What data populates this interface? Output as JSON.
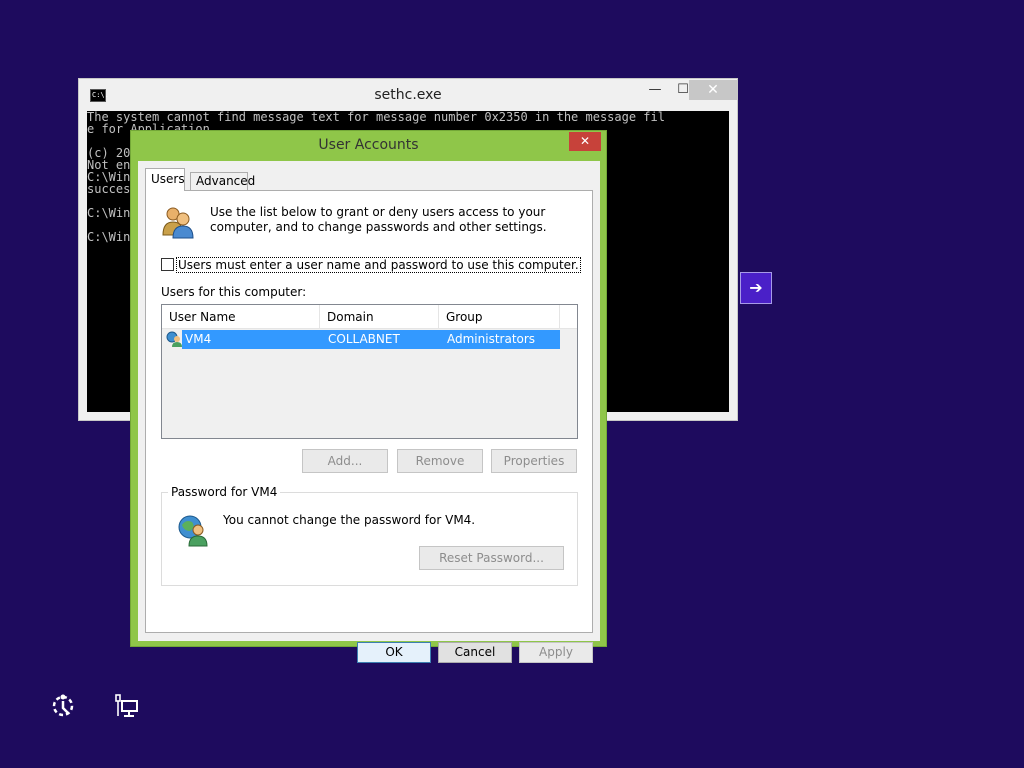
{
  "cmd": {
    "icon_text": "C:\\.",
    "title": "sethc.exe",
    "min_glyph": "—",
    "max_glyph": "☐",
    "close_glyph": "✕",
    "lines": [
      "The system cannot find message text for message number 0x2350 in the message fil",
      "e for Application",
      "",
      "(c) 20",
      "Not en",
      "C:\\Win",
      "succes",
      "",
      "C:\\Win",
      "",
      "C:\\Win"
    ]
  },
  "arrow": {
    "glyph": "➔"
  },
  "dialog": {
    "title": "User Accounts",
    "close_glyph": "✕",
    "tabs": [
      {
        "label": "Users",
        "active": true
      },
      {
        "label": "Advanced",
        "active": false
      }
    ],
    "intro": "Use the list below to grant or deny users access to your computer, and to change passwords and other settings.",
    "checkbox": {
      "label": "Users must enter a user name and password to use this computer.",
      "checked": false
    },
    "list_caption": "Users for this computer:",
    "columns": [
      "User Name",
      "Domain",
      "Group"
    ],
    "rows": [
      {
        "name": "VM4",
        "domain": "COLLABNET",
        "group": "Administrators",
        "selected": true
      }
    ],
    "buttons": {
      "add": "Add...",
      "remove": "Remove",
      "properties": "Properties"
    },
    "password_group": {
      "label": "Password for VM4",
      "message": "You cannot change the password for VM4.",
      "reset": "Reset Password..."
    },
    "footer": {
      "ok": "OK",
      "cancel": "Cancel",
      "apply": "Apply"
    }
  },
  "colors": {
    "desktop": "#1e0b5e",
    "dialog_frame": "#8fc649",
    "selection": "#3399ff",
    "close_red": "#c7423a"
  },
  "icons": [
    "cmd-icon",
    "users-icon",
    "user-row-icon",
    "password-user-icon",
    "arrow-right-icon",
    "ease-of-access-icon",
    "network-icon"
  ]
}
